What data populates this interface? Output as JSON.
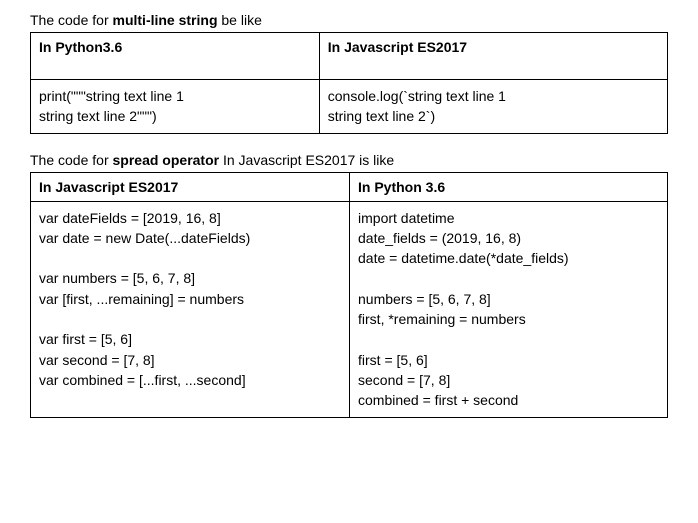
{
  "section1": {
    "intro_prefix": "The code for ",
    "intro_bold": "multi-line string",
    "intro_suffix": " be like",
    "header_left": "In Python3.6",
    "header_right": "In Javascript ES2017",
    "code_left": "print(\"\"\"string text line 1\nstring text line 2\"\"\")",
    "code_right": "console.log(`string text line 1\nstring text line 2`)"
  },
  "section2": {
    "intro_prefix": "The code for ",
    "intro_bold": "spread operator",
    "intro_suffix": " In Javascript ES2017  is like",
    "header_left": "In Javascript ES2017",
    "header_right": "In Python 3.6",
    "code_left": "var dateFields = [2019, 16, 8]\nvar date = new Date(...dateFields)\n\nvar numbers = [5, 6, 7, 8]\nvar [first, ...remaining] = numbers\n\nvar first = [5, 6]\nvar second = [7, 8]\nvar combined = [...first, ...second]",
    "code_right": "import datetime\ndate_fields = (2019, 16, 8)\ndate = datetime.date(*date_fields)\n\nnumbers = [5, 6, 7, 8]\nfirst, *remaining = numbers\n\nfirst = [5, 6]\nsecond = [7, 8]\ncombined = first + second"
  }
}
